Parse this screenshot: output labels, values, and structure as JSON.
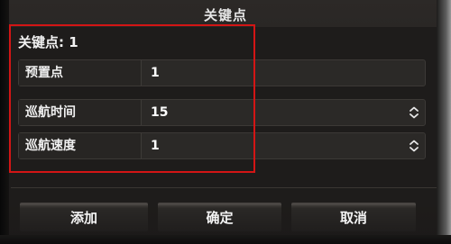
{
  "window": {
    "title": "关键点"
  },
  "keypoint": {
    "label": "关键点: 1"
  },
  "fields": [
    {
      "label": "预置点",
      "value": "1",
      "has_spinner": false
    },
    {
      "label": "巡航时间",
      "value": "15",
      "has_spinner": true
    },
    {
      "label": "巡航速度",
      "value": "1",
      "has_spinner": true
    }
  ],
  "buttons": {
    "add": "添加",
    "ok": "确定",
    "cancel": "取消"
  },
  "colors": {
    "highlight_border": "#d31515",
    "background": "#221f1d",
    "field_bg": "#2b2927",
    "text": "#f0f0f0"
  },
  "icons": {
    "spinner": "up-down-spinner-icon"
  }
}
